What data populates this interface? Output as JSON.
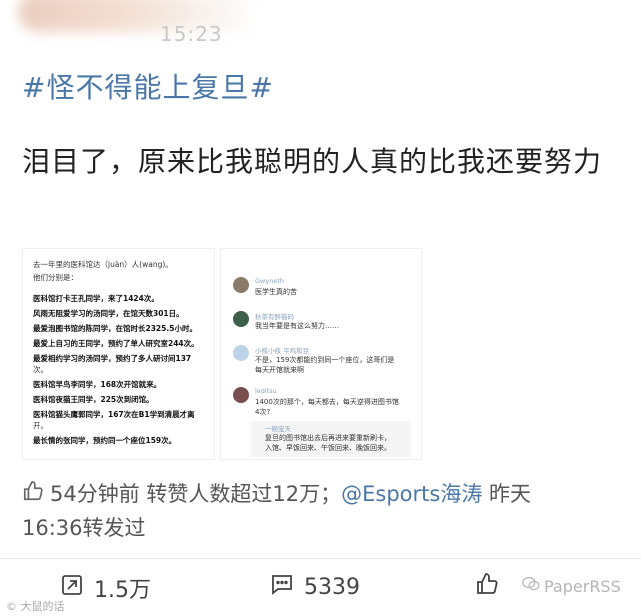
{
  "header": {
    "time": "15:23"
  },
  "post": {
    "hashtag": "#怪不得能上复旦#",
    "text": "泪目了，原来比我聪明的人真的比我还要努力"
  },
  "screenshot_left": {
    "lines": [
      "去一年里的医科馆达（juàn）人(wang)。",
      "他们分别是：",
      "医科馆打卡王孔同学，来了1424次。",
      "风雨无阻爱学习的汤同学，在馆天数301日。",
      "最爱泡图书馆的陈同学，在馆时长2325.5小时。",
      "最爱上自习的王同学，预约了单人研究室244次。",
      "最爱相约学习的汤同学，预约了多人研讨间137",
      "次。",
      "医科馆早鸟李同学，168次开馆就来。",
      "医科馆夜猫王同学，225次到闭馆。",
      "医科馆猫头鹰郭同学，167次在B1学到清晨才离",
      "开。",
      "最长情的张同学，预约同一个座位159次。"
    ]
  },
  "screenshot_right": {
    "comments": [
      {
        "name": "Gwyneth",
        "text": "医学生真的苦"
      },
      {
        "name": "秋茶有醉猫码",
        "text": "我当年要是有这么努力……"
      },
      {
        "name": "小核小核 平鸡和豆",
        "text1": "不是，159次都能约到同一个座位，这哥们是",
        "text2": "每天开馆就来啊"
      },
      {
        "name": "leditsu",
        "text1": "1400次的那个，每天都去，每天逆得进图书馆",
        "text2": "4次?"
      },
      {
        "name": "一碗宝天",
        "text1": "复旦的图书馆出去后再进来要重新刷卡，",
        "text2": "入馆、早饭回来、午饭回来、晚饭回来。"
      }
    ]
  },
  "meta": {
    "prefix": "54分钟前 转赞人数超过12万；",
    "handle": "@Esports海涛",
    "suffix1": " 昨天",
    "suffix2": "16:36转发过"
  },
  "actions": {
    "repost_count": "1.5万",
    "comment_count": "5339"
  },
  "watermarks": {
    "left": "© 大鼠的话",
    "right": "PaperRSS"
  },
  "colors": {
    "link": "#4a77a8",
    "text": "#222222",
    "muted": "#555555"
  }
}
